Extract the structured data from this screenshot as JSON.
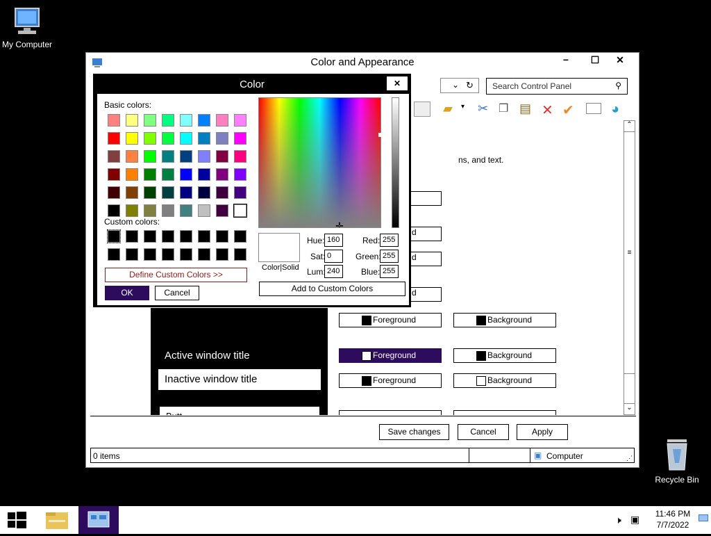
{
  "desktop": {
    "my_computer": "My Computer",
    "recycle_bin": "Recycle Bin"
  },
  "window": {
    "title": "Color and Appearance",
    "search_placeholder": "Search Control Panel",
    "text_snippet": "ns, and text.",
    "preview": {
      "active_title": "Active window title",
      "inactive_title": "Inactive window title",
      "button_partial": "Butt"
    },
    "fg_label": "Foreground",
    "bg_label": "Background",
    "buttons": {
      "save": "Save changes",
      "cancel": "Cancel",
      "apply": "Apply"
    },
    "status": {
      "items": "0 items",
      "location": "Computer"
    }
  },
  "dialog": {
    "title": "Color",
    "basic_label": "Basic colors:",
    "custom_label": "Custom colors:",
    "define_custom": "Define Custom Colors >>",
    "ok": "OK",
    "cancel": "Cancel",
    "add_custom": "Add to Custom Colors",
    "color_solid": "Color|Solid",
    "fields": {
      "hue_label": "Hue:",
      "hue": "160",
      "sat_label": "Sat:",
      "sat": "0",
      "lum_label": "Lum:",
      "lum": "240",
      "red_label": "Red:",
      "red": "255",
      "green_label": "Green:",
      "green": "255",
      "blue_label": "Blue:",
      "blue": "255"
    },
    "basic_colors": [
      "#ff8080",
      "#ffff80",
      "#80ff80",
      "#00ff80",
      "#80ffff",
      "#0080ff",
      "#ff80c0",
      "#ff80ff",
      "#ff0000",
      "#ffff00",
      "#80ff00",
      "#00ff40",
      "#00ffff",
      "#0080c0",
      "#8080c0",
      "#ff00ff",
      "#804040",
      "#ff8040",
      "#00ff00",
      "#008080",
      "#004080",
      "#8080ff",
      "#800040",
      "#ff0080",
      "#800000",
      "#ff8000",
      "#008000",
      "#008040",
      "#0000ff",
      "#0000a0",
      "#800080",
      "#8000ff",
      "#400000",
      "#804000",
      "#004000",
      "#004040",
      "#000080",
      "#000040",
      "#400040",
      "#400080",
      "#000000",
      "#808000",
      "#808040",
      "#808080",
      "#408080",
      "#c0c0c0",
      "#400040",
      "#ffffff"
    ]
  },
  "taskbar": {
    "time": "11:46 PM",
    "date": "7/7/2022"
  },
  "colors": {
    "accent": "#2d0c5e"
  }
}
